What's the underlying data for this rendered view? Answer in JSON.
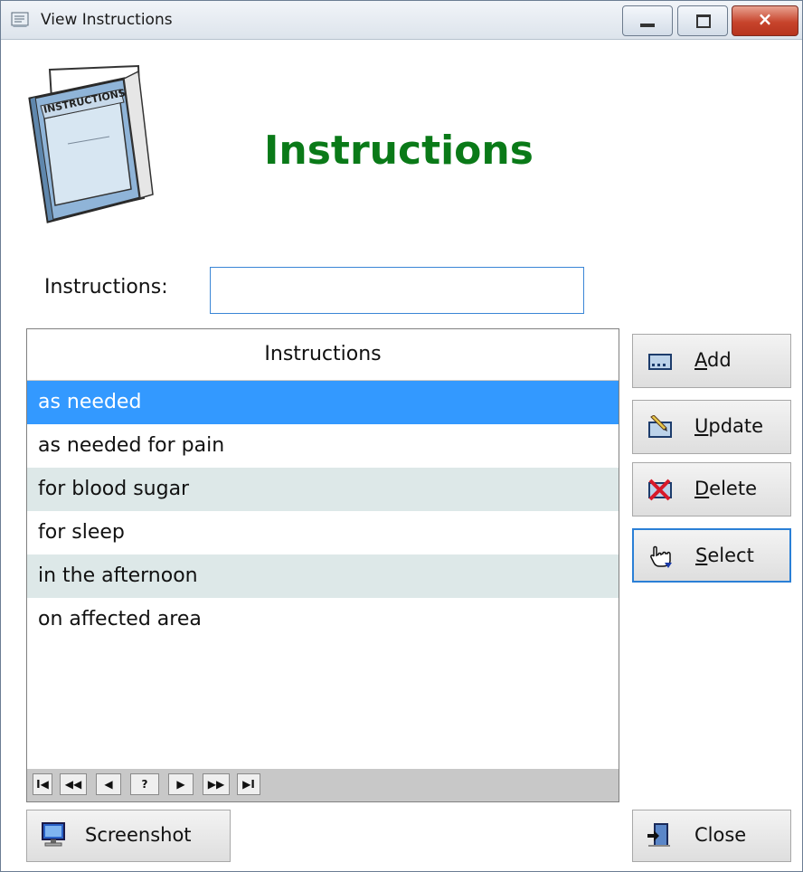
{
  "window": {
    "title": "View Instructions",
    "close_glyph": "×"
  },
  "header": {
    "title": "Instructions",
    "logo_text": "INSTRUCTIONS",
    "logo_icon": "instructions-book-icon"
  },
  "form": {
    "label": "Instructions:",
    "value": "",
    "placeholder": ""
  },
  "grid": {
    "header": "Instructions",
    "rows": [
      "as needed",
      "as needed for pain",
      "for blood sugar",
      "for sleep",
      "in the afternoon",
      "on affected area"
    ],
    "selected_index": 0,
    "nav": [
      "I◀",
      "◀◀",
      "◀",
      "?",
      "▶",
      "▶▶",
      "▶I"
    ]
  },
  "buttons": {
    "add": {
      "pre": "",
      "key": "A",
      "post": "dd",
      "icon": "add-record-icon"
    },
    "update": {
      "pre": "",
      "key": "U",
      "post": "pdate",
      "icon": "update-record-icon"
    },
    "delete": {
      "pre": "",
      "key": "D",
      "post": "elete",
      "icon": "delete-record-icon"
    },
    "select": {
      "pre": "",
      "key": "S",
      "post": "elect",
      "icon": "hand-pointer-icon"
    },
    "screenshot": {
      "label": "Screenshot",
      "icon": "monitor-icon"
    },
    "close": {
      "label": "Close",
      "icon": "exit-door-icon"
    }
  },
  "colors": {
    "title_green": "#0a7a18",
    "selection_blue": "#3399ff",
    "alt_row": "#dde8e8",
    "focus_border": "#2a7fd6"
  }
}
